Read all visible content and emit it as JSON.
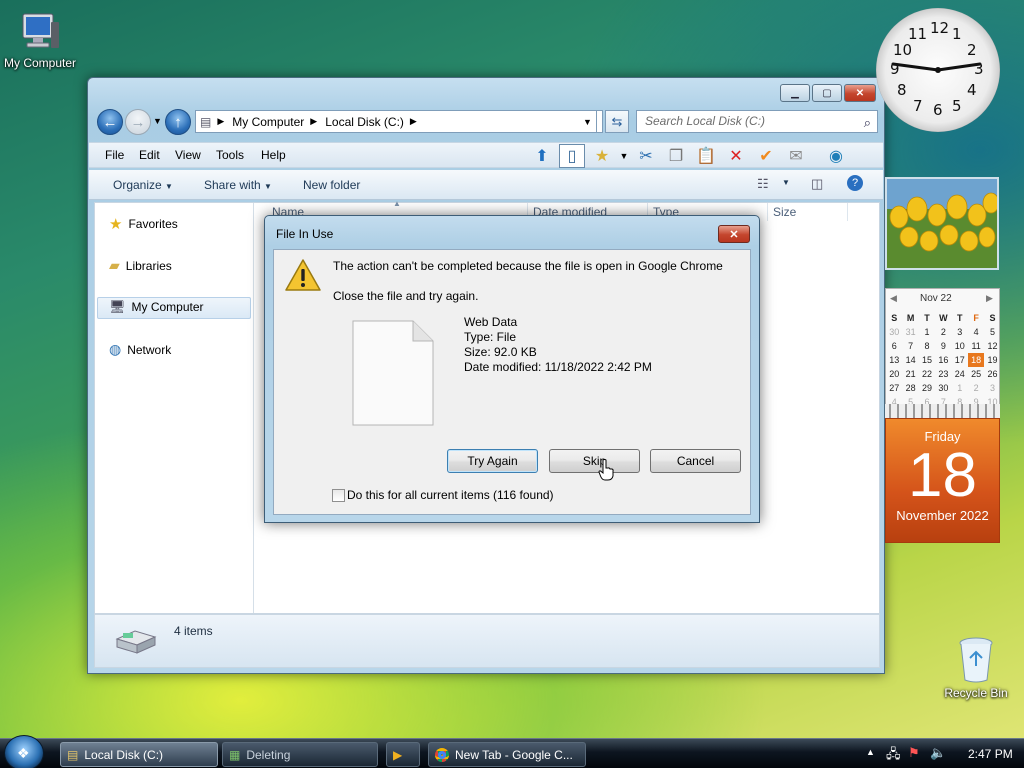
{
  "desktop": {
    "my_computer_label": "My Computer",
    "recycle_bin_label": "Recycle Bin"
  },
  "explorer": {
    "breadcrumb": [
      "My Computer",
      "Local Disk (C:)"
    ],
    "search_placeholder": "Search Local Disk (C:)",
    "menu": [
      "File",
      "Edit",
      "View",
      "Tools",
      "Help"
    ],
    "commands": {
      "organize": "Organize",
      "share_with": "Share with",
      "new_folder": "New folder"
    },
    "nav_items": [
      "Favorites",
      "Libraries",
      "My Computer",
      "Network"
    ],
    "columns": [
      "Name",
      "Date modified",
      "Type",
      "Size"
    ],
    "status_count": "4 items"
  },
  "dialog": {
    "title": "File In Use",
    "message": "The action can't be completed because the file is open in Google Chrome",
    "instruction": "Close the file and try again.",
    "file": {
      "name": "Web Data",
      "type": "Type: File",
      "size": "Size: 92.0 KB",
      "modified": "Date modified: 11/18/2022 2:42 PM"
    },
    "buttons": {
      "try_again": "Try Again",
      "skip": "Skip",
      "cancel": "Cancel"
    },
    "checkbox_label": "Do this for all current items (116 found)",
    "checkbox_checked": false
  },
  "gadgets": {
    "clock_numbers": [
      "12",
      "1",
      "2",
      "3",
      "4",
      "5",
      "6",
      "7",
      "8",
      "9",
      "10",
      "11"
    ],
    "calendar": {
      "month": "Nov 22",
      "weekdays": [
        "S",
        "M",
        "T",
        "W",
        "T",
        "F",
        "S"
      ],
      "weeks": [
        [
          "30",
          "31",
          "1",
          "2",
          "3",
          "4",
          "5"
        ],
        [
          "6",
          "7",
          "8",
          "9",
          "10",
          "11",
          "12"
        ],
        [
          "13",
          "14",
          "15",
          "16",
          "17",
          "18",
          "19"
        ],
        [
          "20",
          "21",
          "22",
          "23",
          "24",
          "25",
          "26"
        ],
        [
          "27",
          "28",
          "29",
          "30",
          "1",
          "2",
          "3"
        ],
        [
          "4",
          "5",
          "6",
          "7",
          "8",
          "9",
          "10"
        ]
      ],
      "today": "18",
      "day_name": "Friday",
      "day_number": "18",
      "month_year": "November 2022"
    }
  },
  "taskbar": {
    "tasks": [
      {
        "label": "Local Disk (C:)",
        "icon": "folder-icon"
      },
      {
        "label": "Deleting",
        "icon": "delete-progress-icon"
      },
      {
        "label": "New Tab - Google C...",
        "icon": "chrome-icon"
      }
    ],
    "time": "2:47 PM"
  },
  "colors": {
    "accent_orange": "#e8781e",
    "dialog_frame": "#b8d6ea"
  }
}
